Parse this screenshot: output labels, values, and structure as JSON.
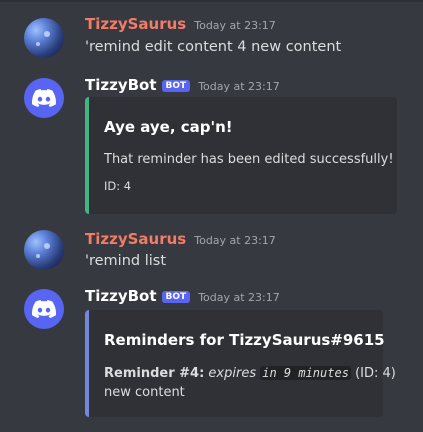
{
  "messages": [
    {
      "author": "TizzySaurus",
      "timestamp": "Today at 23:17",
      "text": "'remind edit content 4 new content"
    },
    {
      "author": "TizzyBot",
      "badge": "BOT",
      "timestamp": "Today at 23:17",
      "embed": {
        "title": "Aye aye, cap'n!",
        "description": "That reminder has been edited successfully!",
        "footer": "ID: 4",
        "accent": "#43b581"
      }
    },
    {
      "author": "TizzySaurus",
      "timestamp": "Today at 23:17",
      "text": "'remind list"
    },
    {
      "author": "TizzyBot",
      "badge": "BOT",
      "timestamp": "Today at 23:17",
      "embed": {
        "title": "Reminders for TizzySaurus#9615",
        "reminder_label": "Reminder #4:",
        "expires_label": "expires",
        "expires_value": "in 9 minutes",
        "id_text": "(ID: 4)",
        "content": "new content",
        "accent": "#7289da"
      }
    }
  ],
  "colors": {
    "background": "#36393f",
    "embed_bg": "#2f3136",
    "username_user": "#f47b67",
    "bot_badge": "#5865f2"
  },
  "icons": {
    "user_avatar": "user-avatar-icon",
    "bot_avatar": "discord-logo-icon"
  }
}
